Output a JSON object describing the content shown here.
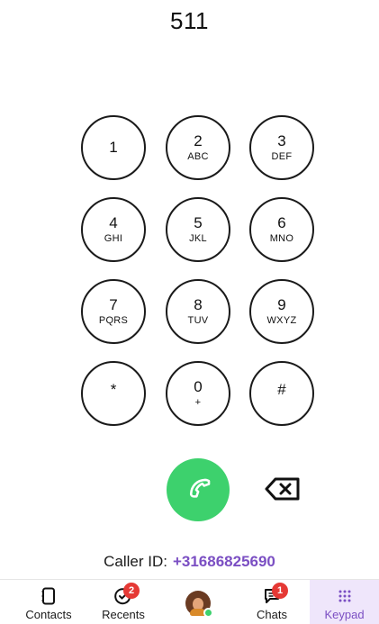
{
  "dialer": {
    "number": "511"
  },
  "keypad": [
    {
      "digit": "1",
      "letters": ""
    },
    {
      "digit": "2",
      "letters": "ABC"
    },
    {
      "digit": "3",
      "letters": "DEF"
    },
    {
      "digit": "4",
      "letters": "GHI"
    },
    {
      "digit": "5",
      "letters": "JKL"
    },
    {
      "digit": "6",
      "letters": "MNO"
    },
    {
      "digit": "7",
      "letters": "PQRS"
    },
    {
      "digit": "8",
      "letters": "TUV"
    },
    {
      "digit": "9",
      "letters": "WXYZ"
    },
    {
      "digit": "*",
      "letters": ""
    },
    {
      "digit": "0",
      "letters": "+"
    },
    {
      "digit": "#",
      "letters": ""
    }
  ],
  "call": {
    "icon": "phone-icon",
    "color": "#3dd16d"
  },
  "backspace": {
    "icon": "backspace-icon"
  },
  "caller_id": {
    "label": "Caller ID:",
    "number": "+31686825690",
    "number_color": "#7b4fc3"
  },
  "tabs": [
    {
      "label": "Contacts",
      "icon": "contacts-icon",
      "badge": ""
    },
    {
      "label": "Recents",
      "icon": "recents-icon",
      "badge": "2"
    },
    {
      "label": "",
      "icon": "avatar",
      "badge": ""
    },
    {
      "label": "Chats",
      "icon": "chat-icon",
      "badge": "1"
    },
    {
      "label": "Keypad",
      "icon": "keypad-icon",
      "badge": "",
      "active": true
    }
  ]
}
